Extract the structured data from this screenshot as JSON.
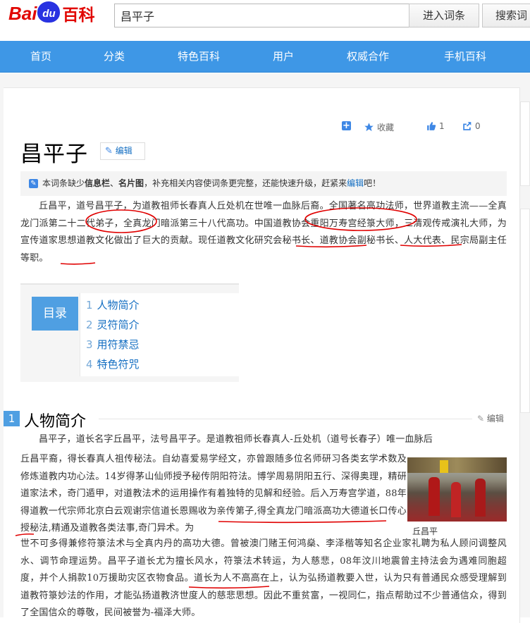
{
  "search": {
    "query": "昌平子",
    "enter_label": "进入词条",
    "search_label": "搜索词"
  },
  "logo": {
    "bai": "Bai",
    "du": "du",
    "baike": "百科"
  },
  "nav": [
    "首页",
    "分类",
    "特色百科",
    "用户",
    "权威合作",
    "手机百科"
  ],
  "tools": {
    "collect": "收藏",
    "likes": "1",
    "shares": "0"
  },
  "title": "昌平子",
  "edit_label": "编辑",
  "notice": {
    "pre": "本词条缺少",
    "b1": "信息栏",
    "sep": "、",
    "b2": "名片图",
    "mid": "，补充相关内容使词条更完整，还能快速升级，赶紧来",
    "link": "编辑",
    "post": "吧！"
  },
  "intro": "丘昌平，道号昌平子，为道教祖师长春真人丘处机在世唯一血脉后裔。全国著名高功法师，世界道教主流——全真龙门派第二十二代弟子，全真龙门暗派第三十八代高功。中国道教协会重阳万寿宫经箓大师，三清观传戒演礼大师，为宣传道家思想道教文化做出了巨大的贡献。现任道教文化研究会秘书长、道教协会副秘书长、人大代表、民宗局副主任等职。",
  "toc": {
    "label": "目录",
    "items": [
      {
        "n": "1",
        "t": "人物简介"
      },
      {
        "n": "2",
        "t": "灵符简介"
      },
      {
        "n": "3",
        "t": "用符禁忌"
      },
      {
        "n": "4",
        "t": "特色符咒"
      }
    ]
  },
  "section1": {
    "num": "1",
    "title": "人物简介",
    "edit": "编辑"
  },
  "bio_line1": "昌平子，道长名字丘昌平，法号昌平子。是道教祖师长春真人-丘处机（道号长春子）唯一血脉后",
  "bio_col": "丘昌平裔，得长春真人祖传秘法。自幼喜爱易学经文，亦曾跟随多位名师研习各类玄学术数及修炼道教内功心法。14岁得茅山仙师授予秘传阴阳符法。博学周易阴阳五行、深得奥理，精研道家法术，奇门遁甲，对道教法术的运用操作有着独特的见解和经验。后入万寿宫学道，88年得道教一代宗师北京白云观谢宗信道长恩赐收为亲传第子,得全真龙门暗派高功大德道长口传心授秘法,精通及道教各类法事,奇门异术。为",
  "bio_rest": "世不可多得兼修符箓法术与全真内丹的高功大德。曾被澳门赌王何鸿燊、李泽楷等知名企业家礼聘为私人顾问调整风水、调节命理运势。昌平子道长尤为擅长风水，符箓法术转运，为人慈悲，08年汶川地震曾主持法会为遇难同胞超度，并个人捐款10万援助灾区衣物食品。道长为人不高高在上，认为弘扬道教要入世，认为只有普通民众感受理解到道教符箓妙法的作用，才能弘扬道教济世度人的慈悲思想。因此不重贫富，一视同仁，指点帮助过不少普通信众，得到了全国信众的尊敬，民间被誉为-福泽大师。",
  "photo_caption": "丘昌平",
  "colors": {
    "nav": "#3e97e6",
    "link": "#136ec2",
    "accent": "#4f9fe2",
    "ink": "#e00000"
  }
}
